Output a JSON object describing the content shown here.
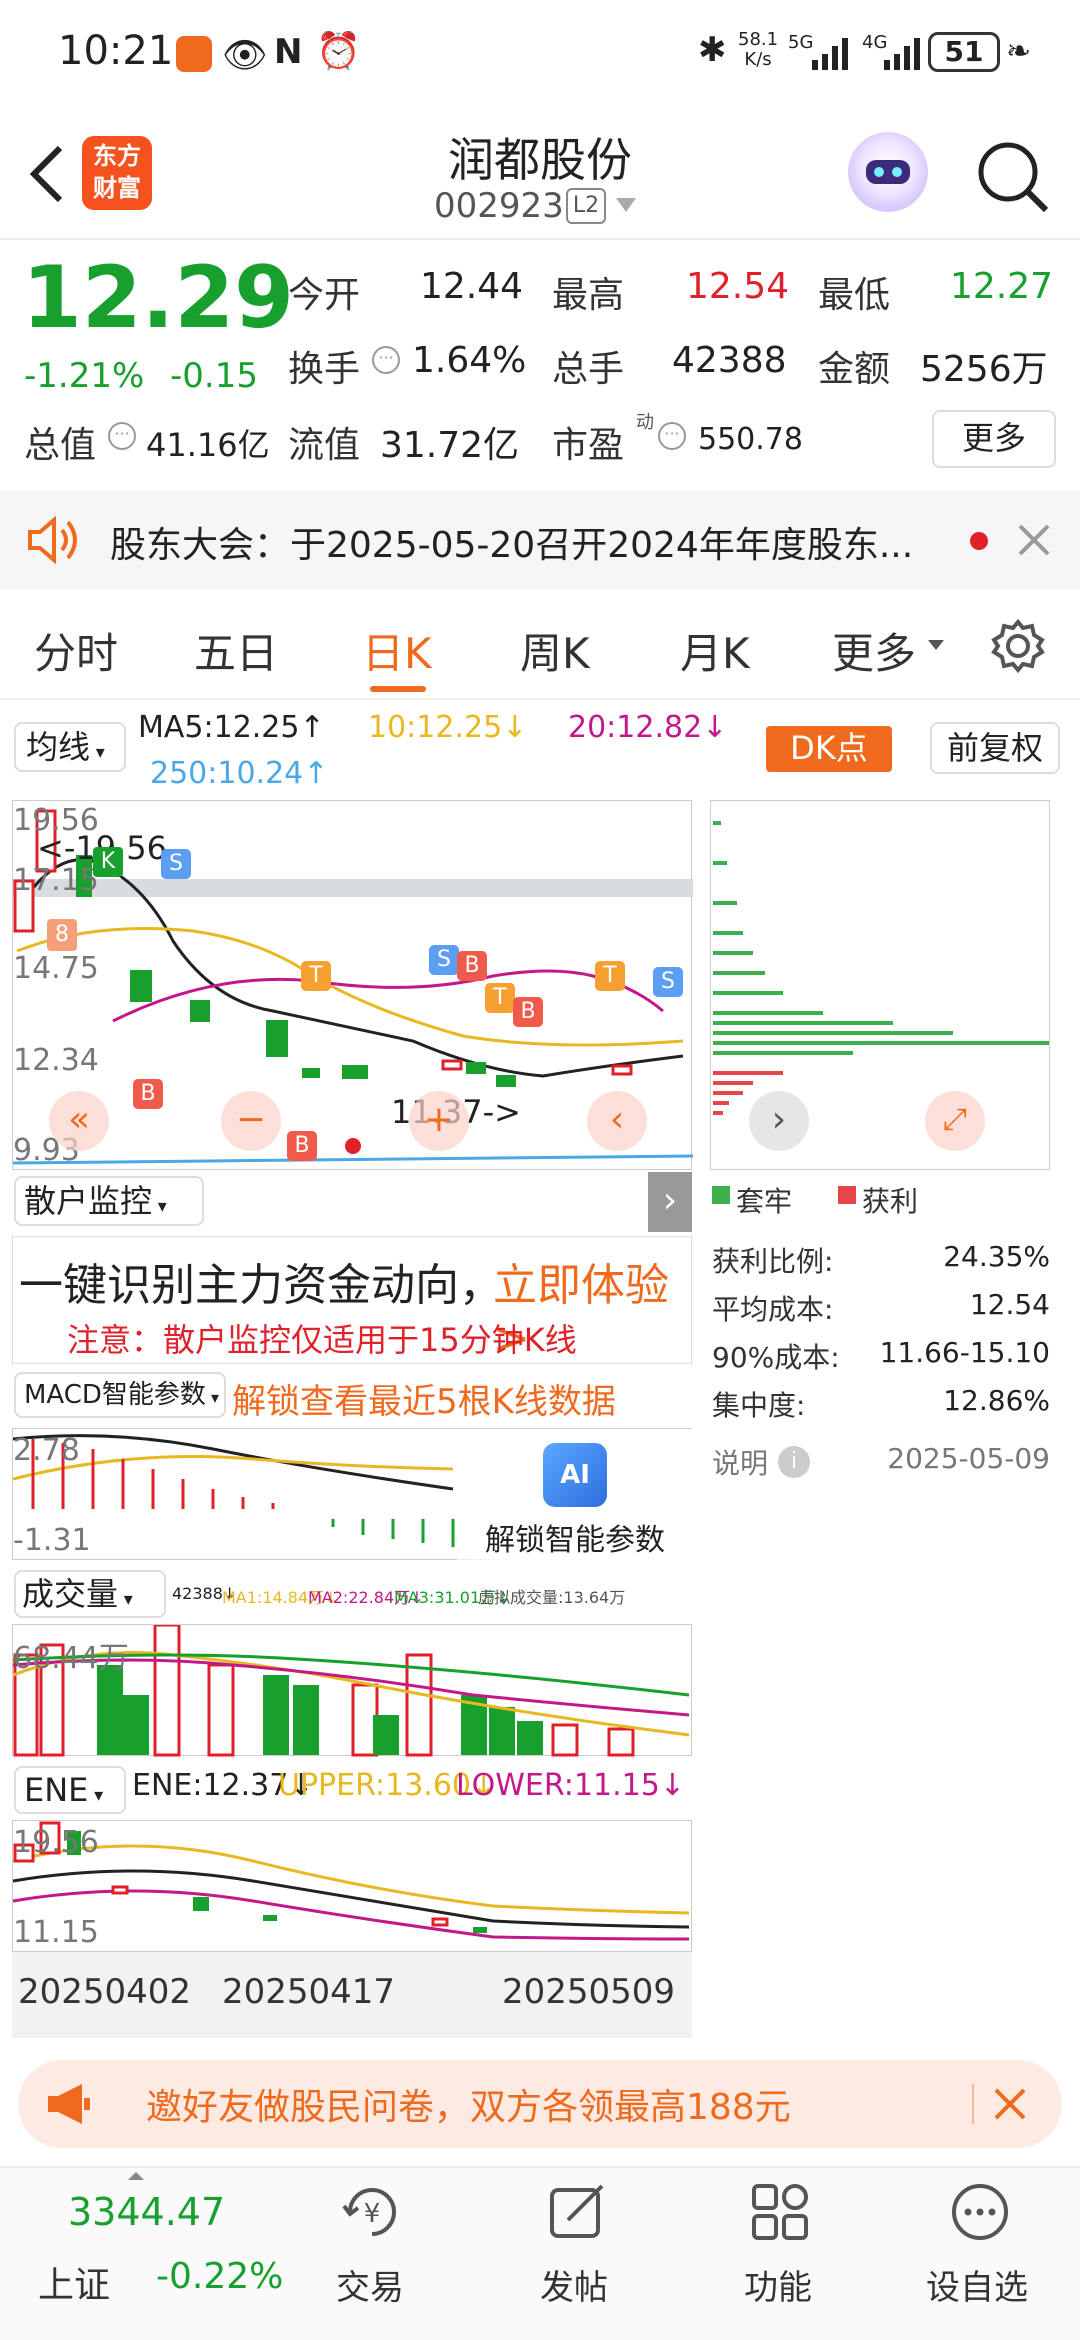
{
  "status": {
    "time": "10:21",
    "speed_top": "58.1",
    "speed_unit": "K/s",
    "net1": "5G",
    "net2": "4G",
    "battery": "51"
  },
  "header": {
    "name": "润都股份",
    "code": "002923",
    "badge": "L2",
    "logo_line1": "东方",
    "logo_line2": "财富"
  },
  "quote": {
    "price": "12.29",
    "change_pct": "-1.21%",
    "change_amt": "-0.15",
    "open_label": "今开",
    "open": "12.44",
    "high_label": "最高",
    "high": "12.54",
    "low_label": "最低",
    "low": "12.27",
    "turnover_label": "换手",
    "turnover": "1.64%",
    "vol_label": "总手",
    "vol": "42388",
    "amount_label": "金额",
    "amount": "5256万",
    "mcap_label": "总值",
    "mcap": "41.16亿",
    "float_label": "流值",
    "float": "31.72亿",
    "pe_label": "市盈",
    "pe_sup": "动",
    "pe": "550.78",
    "more": "更多"
  },
  "notice": {
    "text": "股东大会：于2025-05-20召开2024年年度股东..."
  },
  "tabs": [
    "分时",
    "五日",
    "日K",
    "周K",
    "月K",
    "更多"
  ],
  "ma": {
    "selector": "均线",
    "ma5": "MA5:12.25↑",
    "ma10": "10:12.25↓",
    "ma20": "20:12.82↓",
    "ma250": "250:10.24↑",
    "dk": "DK点",
    "fq": "前复权"
  },
  "kchart": {
    "max_label": "19.56",
    "arrow_label": "<-19.56",
    "p1": "17.15",
    "p2": "14.75",
    "p3": "12.34",
    "p4": "9.93",
    "min_label": "11.37->",
    "s": "S",
    "b": "B",
    "t": "T",
    "k": "K"
  },
  "chips": {
    "legend_a": "套牢",
    "legend_b": "获利",
    "profit_label": "获利比例:",
    "profit": "24.35%",
    "avg_label": "平均成本:",
    "avg": "12.54",
    "c90_label": "90%成本:",
    "c90": "11.66-15.10",
    "conc_label": "集中度:",
    "conc": "12.86%",
    "note": "说明",
    "date": "2025-05-09"
  },
  "retail": {
    "selector": "散户监控",
    "headline": "一键识别主力资金动向，",
    "cta": "立即体验>",
    "warn": "注意：散户监控仅适用于15分钟K线"
  },
  "macd": {
    "selector": "MACD智能参数",
    "unlock": "解锁查看最近5根K线数据",
    "top": "2.78",
    "bottom": "-1.31",
    "ai": "AI",
    "ai_label": "解锁智能参数"
  },
  "volume": {
    "selector": "成交量",
    "info": "42388↓",
    "ma1": "MA1:14.84万↓",
    "ma2": "MA2:22.84万↓",
    "ma3": "MA3:31.01万↓",
    "virt": "虚拟成交量:13.64万",
    "top": "68.44万"
  },
  "ene": {
    "selector": "ENE",
    "ene": "ENE:12.37↓",
    "upper": "UPPER:13.60↓",
    "lower": "LOWER:11.15↓",
    "top": "19.56",
    "bottom": "11.15"
  },
  "dates": [
    "20250402",
    "20250417",
    "20250509"
  ],
  "promo": {
    "text": "邀好友做股民问卷，双方各领最高188元"
  },
  "bottom": {
    "index_value": "3344.47",
    "index_name": "上证",
    "index_change": "-0.22%",
    "items": [
      "交易",
      "发帖",
      "功能",
      "设自选"
    ]
  },
  "colors": {
    "up": "#e0212a",
    "down": "#17a02d",
    "accent": "#f06a1e"
  }
}
